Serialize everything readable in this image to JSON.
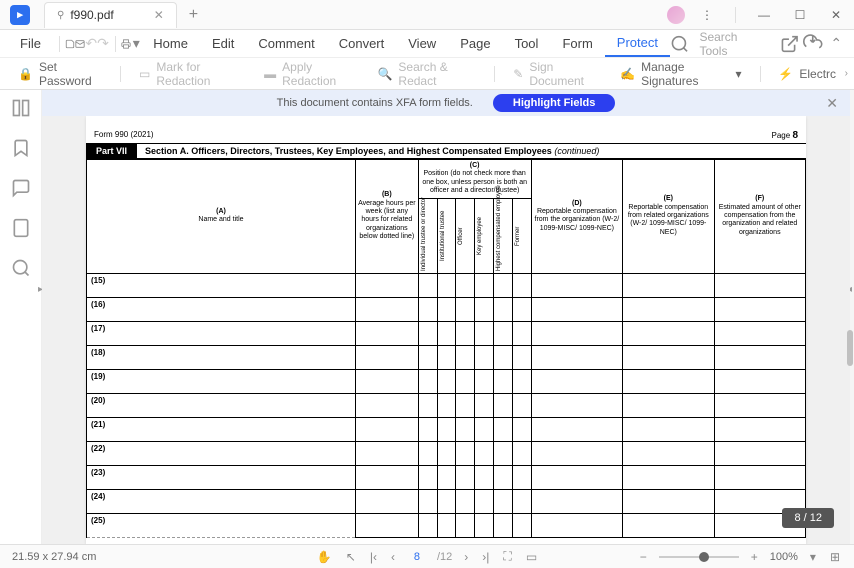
{
  "app": {
    "tab_name": "f990.pdf"
  },
  "menu": {
    "file": "File",
    "items": [
      "Home",
      "Edit",
      "Comment",
      "Convert",
      "View",
      "Page",
      "Tool",
      "Form",
      "Protect"
    ],
    "active": 8,
    "search_ph": "Search Tools"
  },
  "toolbar": {
    "set_password": "Set Password",
    "mark_redaction": "Mark for Redaction",
    "apply_redaction": "Apply Redaction",
    "search_redact": "Search & Redact",
    "sign_document": "Sign Document",
    "manage_sig": "Manage Signatures",
    "electronic": "Electrc"
  },
  "notif": {
    "text": "This document contains XFA form fields.",
    "button": "Highlight Fields"
  },
  "form": {
    "title_left": "Form 990 (2021)",
    "page_label": "Page",
    "page_num": "8",
    "part": "Part VII",
    "section_title": "Section A. Officers, Directors, Trustees, Key Employees, and Highest Compensated Employees",
    "continued": "(continued)",
    "cols": {
      "a": "(A)",
      "a_sub": "Name and title",
      "b": "(B)",
      "b_sub": "Average hours per week (list any hours for related organizations below dotted line)",
      "c": "(C)",
      "c_sub": "Position (do not check more than one box, unless person is both an officer and a director/trustee)",
      "c1": "Individual trustee or director",
      "c2": "Institutional trustee",
      "c3": "Officer",
      "c4": "Key employee",
      "c5": "Highest compensated employee",
      "c6": "Former",
      "d": "(D)",
      "d_sub": "Reportable compensation from the organization (W-2/ 1099-MISC/ 1099-NEC)",
      "e": "(E)",
      "e_sub": "Reportable compensation from related organizations (W-2/ 1099-MISC/ 1099-NEC)",
      "f": "(F)",
      "f_sub": "Estimated amount of other compensation from the organization and related organizations"
    },
    "rows": [
      "(15)",
      "(16)",
      "(17)",
      "(18)",
      "(19)",
      "(20)",
      "(21)",
      "(22)",
      "(23)",
      "(24)",
      "(25)"
    ]
  },
  "status": {
    "dims": "21.59 x 27.94 cm",
    "page_cur": "8",
    "page_total": "/12",
    "page_indicator": "8 / 12",
    "zoom": "100%"
  }
}
